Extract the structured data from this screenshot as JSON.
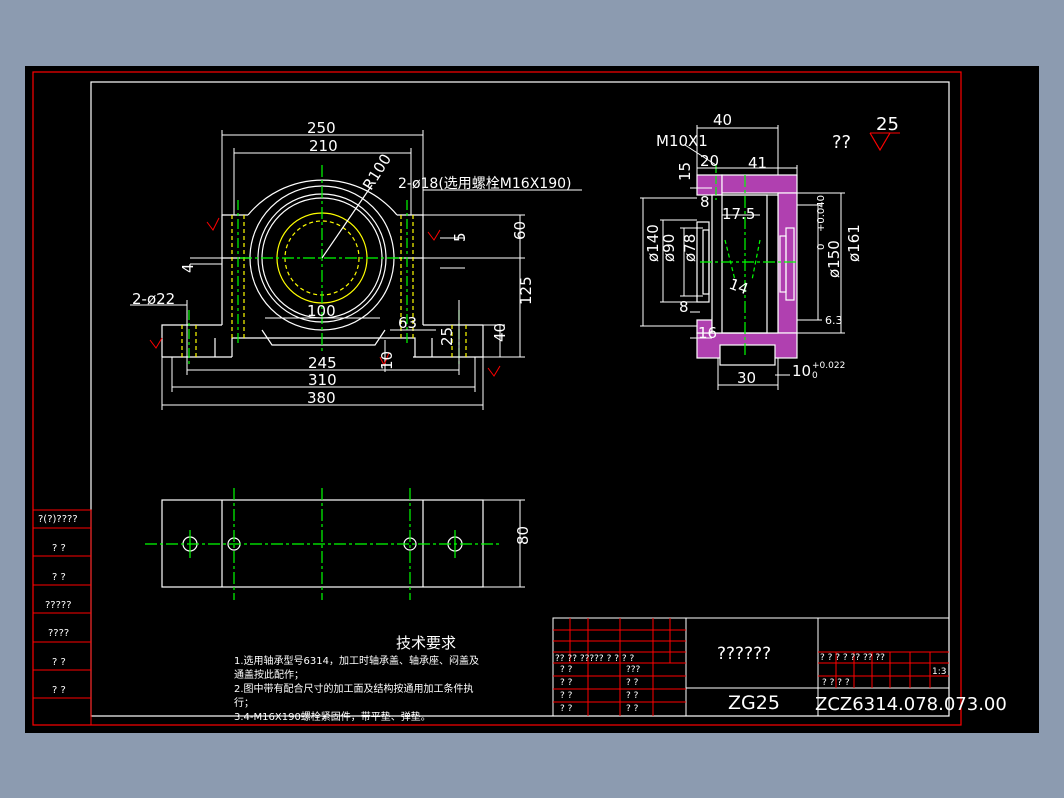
{
  "colors": {
    "background": "#8c9bb0",
    "sheet": "#000000",
    "frame_red": "#ff0000",
    "frame_white": "#ffffff",
    "dims": "#ffffff",
    "center": "#00ff00",
    "hidden": "#ffff00",
    "section": "#c040c0",
    "title": "#ffffff"
  },
  "front_view": {
    "dims": {
      "d250": "250",
      "d210": "210",
      "r100": "R100",
      "holes_top": "2-ø18(选用螺栓M16X190)",
      "d60": "60",
      "d5": "5",
      "d4": "4",
      "holes_bottom": "2-ø22",
      "d100": "100",
      "d63": "63",
      "d125": "125",
      "d25": "25",
      "d40": "40",
      "d245": "245",
      "d10": "10",
      "d310": "310",
      "d380": "380"
    }
  },
  "side_view": {
    "dims": {
      "d40": "40",
      "m10": "M10X1",
      "d20": "20",
      "d41": "41",
      "d15": "15",
      "d8a": "8",
      "d17_5": "17.5",
      "phi140": "ø140",
      "phi90": "ø90",
      "phi78": "ø78",
      "d14": "14",
      "d8b": "8",
      "d16": "16",
      "phi150": "ø150",
      "tol150": "+0.040",
      "tol150b": "0",
      "phi161": "ø161",
      "d6_3": "6.3",
      "d30": "30",
      "d10tol": "10",
      "tol10a": "+0.022",
      "tol10b": "0"
    },
    "rough_label": "??",
    "rough_value": "25"
  },
  "top_view": {
    "dims": {
      "d80": "80"
    }
  },
  "side_table": {
    "rows": [
      "?(?)????",
      "?  ?",
      "?  ?",
      "?????",
      "????",
      "?  ?",
      "?  ?"
    ]
  },
  "tech_req": {
    "title": "技术要求",
    "lines": [
      "1.选用轴承型号6314，加工时轴承盖、轴承座、闷盖及",
      "通盖按此配作；",
      "2.图中带有配合尺寸的加工面及结构按通用加工条件执",
      "行；",
      "3.4-M16X190螺栓紧固件，带平垫、弹垫。"
    ]
  },
  "title_block": {
    "name": "??????",
    "material": "ZG25",
    "code": "ZCZ6314.078.073.00",
    "scale": "1:3",
    "header_row": "?? ??  ????? ? ? ? ?",
    "left_cells": [
      "?  ?",
      "?  ?",
      "?  ?",
      "?  ?"
    ],
    "mid_cells": [
      "???",
      "?  ?",
      "?  ?",
      "?  ?"
    ],
    "right_header": "?  ?  ?  ?   ??  ??  ??",
    "right_bottom": "?        ?        ?        ?"
  }
}
